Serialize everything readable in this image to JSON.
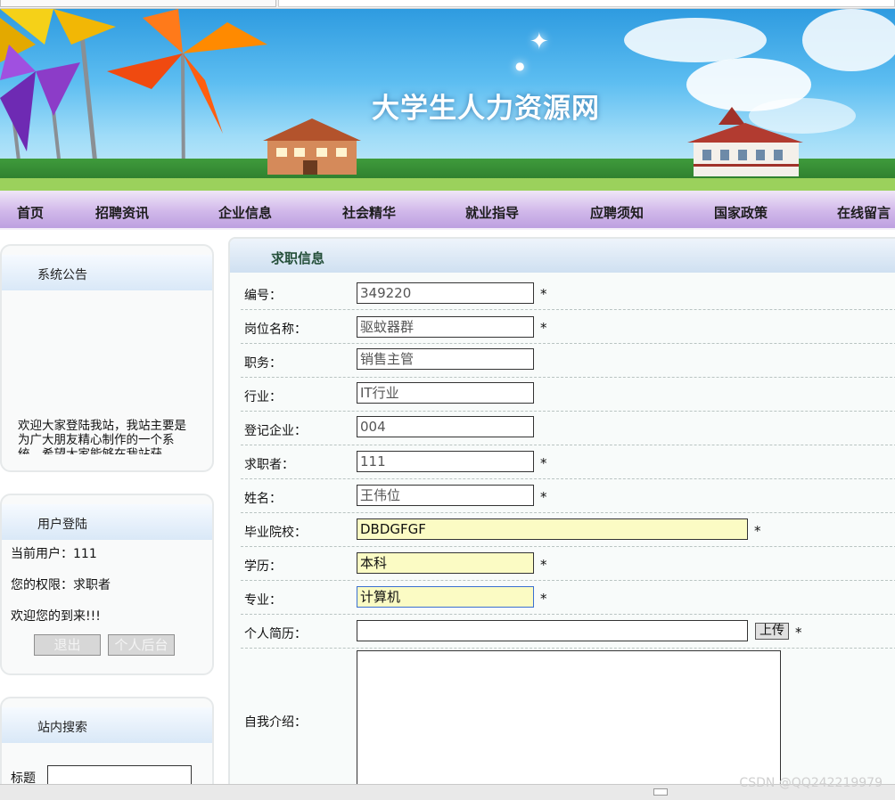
{
  "site": {
    "title": "大学生人力资源网"
  },
  "nav": {
    "items": [
      "首页",
      "招聘资讯",
      "企业信息",
      "社会精华",
      "就业指导",
      "应聘须知",
      "国家政策",
      "在线留言"
    ]
  },
  "sidebar": {
    "notice": {
      "title": "系统公告",
      "text": "欢迎大家登陆我站，我站主要是为广大朋友精心制作的一个系统，希望大家能够在我站获"
    },
    "login": {
      "title": "用户登陆",
      "current_user": "当前用户：111",
      "role": "您的权限：求职者",
      "welcome": "欢迎您的到来!!!",
      "logout_label": "退出",
      "backend_label": "个人后台"
    },
    "search": {
      "title": "站内搜索",
      "field_label": "标题"
    }
  },
  "main": {
    "title": "求职信息",
    "required_mark": "*",
    "fields": {
      "id": {
        "label": "编号：",
        "value": "349220"
      },
      "position": {
        "label": "岗位名称：",
        "value": "驱蚊器群"
      },
      "duty": {
        "label": "职务：",
        "value": "销售主管"
      },
      "industry": {
        "label": "行业：",
        "value": "IT行业"
      },
      "company": {
        "label": "登记企业：",
        "value": "004"
      },
      "seeker": {
        "label": "求职者：",
        "value": "111"
      },
      "name": {
        "label": "姓名：",
        "value": "王伟位"
      },
      "school": {
        "label": "毕业院校：",
        "value": "DBDGFGF"
      },
      "education": {
        "label": "学历：",
        "value": "本科"
      },
      "major": {
        "label": "专业：",
        "value": "计算机"
      },
      "resume": {
        "label": "个人简历：",
        "value": ""
      },
      "intro": {
        "label": "自我介绍："
      }
    },
    "upload_label": "上传"
  },
  "watermark": "CSDN @QQ242219979"
}
